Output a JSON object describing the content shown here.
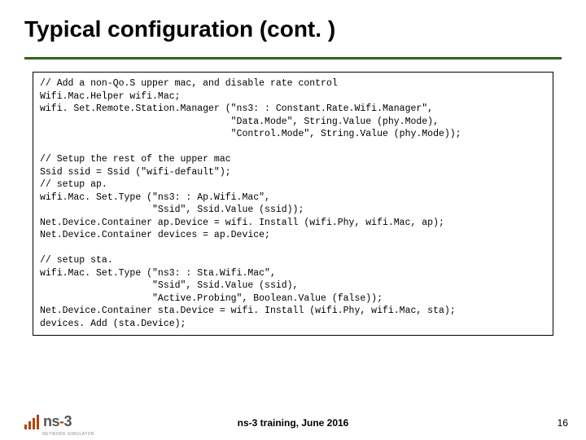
{
  "title": "Typical configuration (cont. )",
  "code": "// Add a non-Qo.S upper mac, and disable rate control\nWifi.Mac.Helper wifi.Mac;\nwifi. Set.Remote.Station.Manager (\"ns3: : Constant.Rate.Wifi.Manager\",\n                                  \"Data.Mode\", String.Value (phy.Mode),\n                                  \"Control.Mode\", String.Value (phy.Mode));\n\n// Setup the rest of the upper mac\nSsid ssid = Ssid (\"wifi-default\");\n// setup ap.\nwifi.Mac. Set.Type (\"ns3: : Ap.Wifi.Mac\",\n                    \"Ssid\", Ssid.Value (ssid));\nNet.Device.Container ap.Device = wifi. Install (wifi.Phy, wifi.Mac, ap);\nNet.Device.Container devices = ap.Device;\n\n// setup sta.\nwifi.Mac. Set.Type (\"ns3: : Sta.Wifi.Mac\",\n                    \"Ssid\", Ssid.Value (ssid),\n                    \"Active.Probing\", Boolean.Value (false));\nNet.Device.Container sta.Device = wifi. Install (wifi.Phy, wifi.Mac, sta);\ndevices. Add (sta.Device);",
  "footer": "ns-3 training, June 2016",
  "page": "16",
  "logo": {
    "text_prefix": "ns",
    "text_dash": "-",
    "text_suffix": "3",
    "subtext": "NETWORK SIMULATOR"
  }
}
